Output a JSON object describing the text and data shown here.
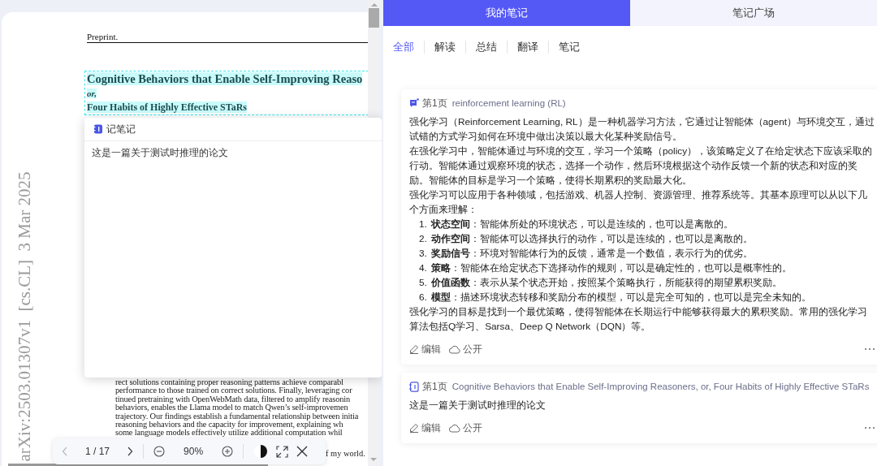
{
  "pdf_viewer": {
    "page": {
      "header": "Preprint.",
      "side_label": "arXiv:2503.01307v1  [cs.CL]  3 Mar 2025",
      "title_lines": [
        {
          "kind": "title",
          "text": "Cognitive Behaviors that Enable Self-Improving Reaso"
        },
        {
          "kind": "connector",
          "text": "or,"
        },
        {
          "kind": "subtitle",
          "text": "Four Habits of Highly Effective STaRs"
        }
      ],
      "body_lines": [
        "rect solutions containing proper reasoning patterns achieve comparabl",
        "performance to those trained on correct solutions. Finally, leveraging cor",
        "tinued pretraining with OpenWebMath data, filtered to amplify reasonin",
        "behaviors, enables the Llama model to match Qwen’s self-improvemen",
        "trajectory. Our findings establish a fundamental relationship between initia",
        "reasoning behaviors and the capacity for improvement, explaining wh",
        "some language models effectively utilize additional computation whil"
      ],
      "trailing_text": "f my world."
    },
    "note_popup": {
      "title": "记笔记",
      "value": "这是一篇关于测试时推理的论文"
    },
    "toolbar": {
      "page_indicator": "1 / 17",
      "zoom": "90%",
      "prev_disabled": true,
      "next_disabled": false
    }
  },
  "notes_panel": {
    "tabs": [
      {
        "label": "我的笔记",
        "selected": true
      },
      {
        "label": "笔记广场",
        "selected": false
      }
    ],
    "filters": [
      {
        "label": "全部",
        "selected": true
      },
      {
        "label": "解读",
        "selected": false
      },
      {
        "label": "总结",
        "selected": false
      },
      {
        "label": "翻译",
        "selected": false
      },
      {
        "label": "笔记",
        "selected": false
      }
    ],
    "notes": [
      {
        "kind": "annotation",
        "page": "第1页",
        "source": "reinforcement learning (RL)",
        "blocks": [
          {
            "kind": "paragraph",
            "text": "强化学习（Reinforcement Learning, RL）是一种机器学习方法，它通过让智能体（agent）与环境交互，通过试错的方式学习如何在环境中做出决策以最大化某种奖励信号。"
          },
          {
            "kind": "paragraph",
            "text": "在强化学习中，智能体通过与环境的交互，学习一个策略（policy），该策略定义了在给定状态下应该采取的行动。智能体通过观察环境的状态，选择一个动作，然后环境根据这个动作反馈一个新的状态和对应的奖励。智能体的目标是学习一个策略，使得长期累积的奖励最大化。"
          },
          {
            "kind": "paragraph",
            "text": "强化学习可以应用于各种领域，包括游戏、机器人控制、资源管理、推荐系统等。其基本原理可以从以下几个方面来理解："
          },
          {
            "kind": "list",
            "items": [
              {
                "number": "1.",
                "text": "**状态空间**：智能体所处的环境状态，可以是连续的，也可以是离散的。"
              },
              {
                "number": "2.",
                "text": "**动作空间**：智能体可以选择执行的动作，可以是连续的，也可以是离散的。"
              },
              {
                "number": "3.",
                "text": "**奖励信号**：环境对智能体行为的反馈，通常是一个数值，表示行为的优劣。"
              },
              {
                "number": "4.",
                "text": "**策略**：智能体在给定状态下选择动作的规则，可以是确定性的，也可以是概率性的。"
              },
              {
                "number": "5.",
                "text": "**价值函数**：表示从某个状态开始，按照某个策略执行，所能获得的期望累积奖励。"
              },
              {
                "number": "6.",
                "text": "**模型**：描述环境状态转移和奖励分布的模型，可以是完全可知的，也可以是完全未知的。"
              }
            ]
          },
          {
            "kind": "paragraph",
            "text": "强化学习的目标是找到一个最优策略，使得智能体在长期运行中能够获得最大的累积奖励。常用的强化学习算法包括Q学习、Sarsa、Deep Q Network（DQN）等。"
          }
        ],
        "actions": [
          "编辑",
          "公开"
        ]
      },
      {
        "kind": "note",
        "page": "第1页",
        "source": "Cognitive Behaviors that Enable Self-Improving Reasoners, or, Four Habits of Highly Effective STaRs",
        "blocks": [
          {
            "kind": "paragraph",
            "text": "这是一篇关于测试时推理的论文"
          }
        ],
        "actions": [
          "编辑",
          "公开"
        ]
      }
    ]
  }
}
